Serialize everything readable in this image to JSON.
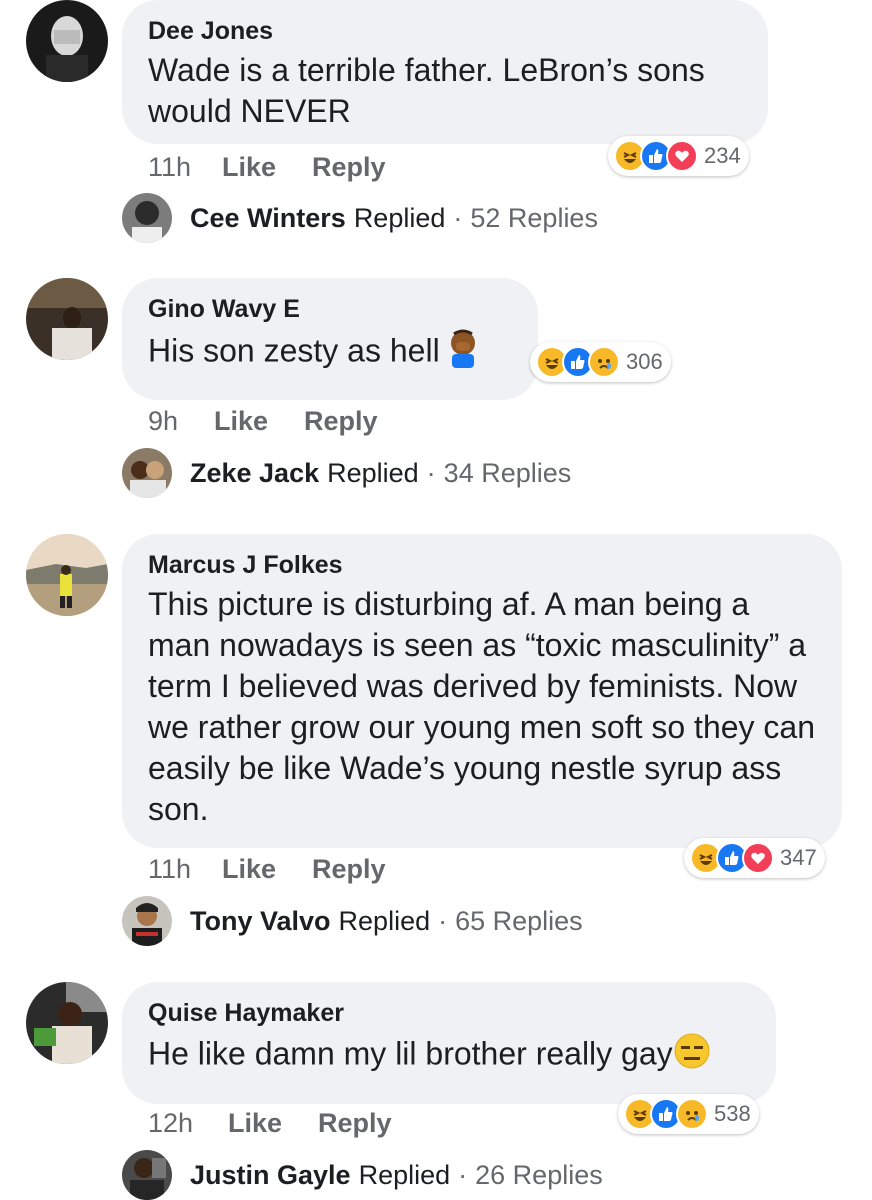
{
  "comments": [
    {
      "author": "Dee Jones",
      "text": "Wade is a terrible father. LeBron’s sons would NEVER",
      "time": "11h",
      "like_label": "Like",
      "reply_label": "Reply",
      "reactions": [
        "haha",
        "like",
        "love"
      ],
      "reaction_count": "234",
      "reply_preview": {
        "name": "Cee Winters",
        "word": "Replied",
        "dot": "·",
        "count": "52 Replies"
      }
    },
    {
      "author": "Gino Wavy E",
      "text": "His son zesty as hell",
      "time": "9h",
      "like_label": "Like",
      "reply_label": "Reply",
      "reactions": [
        "haha",
        "like",
        "sad"
      ],
      "reaction_count": "306",
      "reply_preview": {
        "name": "Zeke Jack",
        "word": "Replied",
        "dot": "·",
        "count": "34 Replies"
      }
    },
    {
      "author": "Marcus J Folkes",
      "text": "This picture is disturbing af. A man being a man nowadays is seen as “toxic masculinity” a term I believed was derived by feminists. Now we rather grow our young men soft so they can easily be like Wade’s young nestle syrup ass son.",
      "time": "11h",
      "like_label": "Like",
      "reply_label": "Reply",
      "reactions": [
        "haha",
        "like",
        "love"
      ],
      "reaction_count": "347",
      "reply_preview": {
        "name": "Tony Valvo",
        "word": "Replied",
        "dot": "·",
        "count": "65 Replies"
      }
    },
    {
      "author": "Quise Haymaker",
      "text": "He like damn my lil brother really gay",
      "time": "12h",
      "like_label": "Like",
      "reply_label": "Reply",
      "reactions": [
        "haha",
        "like",
        "sad"
      ],
      "reaction_count": "538",
      "reply_preview": {
        "name": "Justin Gayle",
        "word": "Replied",
        "dot": "·",
        "count": "26 Replies"
      }
    }
  ],
  "colors": {
    "bubble": "#f0f1f4",
    "like_blue": "#1877f2",
    "love_red": "#f33e58",
    "haha_yellow": "#f7b928",
    "meta_gray": "#65676b"
  },
  "icons": {
    "haha": "haha-reaction-icon",
    "like": "like-reaction-icon",
    "love": "love-reaction-icon",
    "sad": "sad-reaction-icon",
    "facepalm": "facepalm-emoji-icon",
    "expressionless": "expressionless-emoji-icon"
  }
}
